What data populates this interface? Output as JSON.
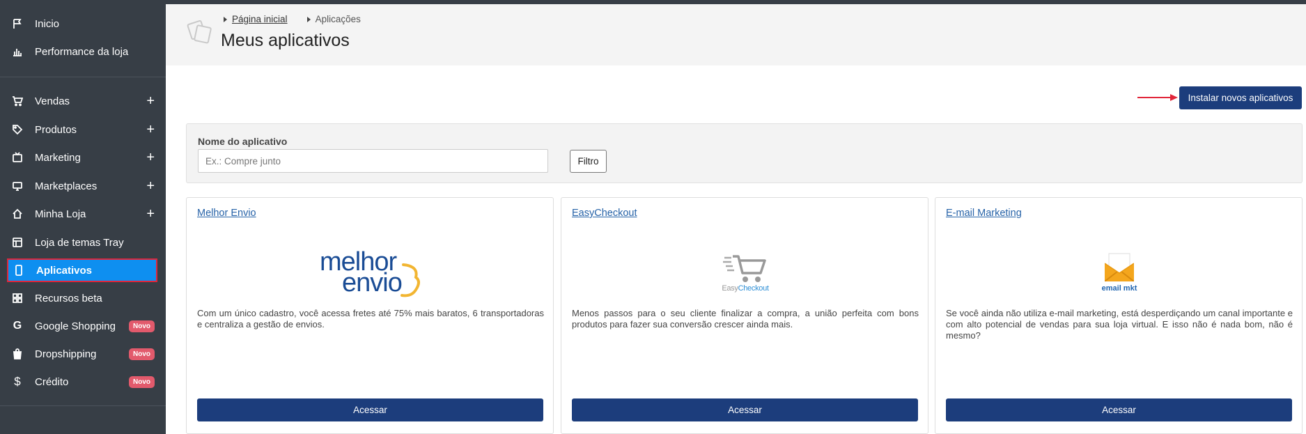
{
  "sidebar": {
    "items": [
      {
        "label": "Inicio",
        "icon": "flag-icon"
      },
      {
        "label": "Performance da loja",
        "icon": "bar-chart-icon"
      },
      {
        "label": "Vendas",
        "icon": "cart-icon",
        "expand": "+"
      },
      {
        "label": "Produtos",
        "icon": "tag-icon",
        "expand": "+"
      },
      {
        "label": "Marketing",
        "icon": "tv-icon",
        "expand": "+"
      },
      {
        "label": "Marketplaces",
        "icon": "monitor-icon",
        "expand": "+"
      },
      {
        "label": "Minha Loja",
        "icon": "home-icon",
        "expand": "+"
      },
      {
        "label": "Loja de temas Tray",
        "icon": "layout-icon"
      },
      {
        "label": "Aplicativos",
        "icon": "phone-icon",
        "active": true
      },
      {
        "label": "Recursos beta",
        "icon": "grid-icon"
      },
      {
        "label": "Google Shopping",
        "icon": "google-icon",
        "badge": "Novo"
      },
      {
        "label": "Dropshipping",
        "icon": "bag-icon",
        "badge": "Novo"
      },
      {
        "label": "Crédito",
        "icon": "dollar-icon",
        "badge": "Novo"
      }
    ]
  },
  "breadcrumb": {
    "home": "Página inicial",
    "current": "Aplicações"
  },
  "page": {
    "title": "Meus aplicativos",
    "install_button": "Instalar novos aplicativos"
  },
  "filter": {
    "label": "Nome do aplicativo",
    "placeholder": "Ex.: Compre junto",
    "button": "Filtro"
  },
  "apps": [
    {
      "title": "Melhor Envio",
      "logo_text_1": "melhor",
      "logo_text_2": "envio",
      "description": "Com um único cadastro, você acessa fretes até 75% mais baratos, 6 transportadoras e centraliza a gestão de envios.",
      "button": "Acessar"
    },
    {
      "title": "EasyCheckout",
      "logo_text_1": "Easy",
      "logo_text_2": "Checkout",
      "description": "Menos passos para o seu cliente finalizar a compra, a união perfeita com bons produtos para fazer sua conversão crescer ainda mais.",
      "button": "Acessar"
    },
    {
      "title": "E-mail Marketing",
      "logo_text_1": "email mkt",
      "description": "Se você ainda não utiliza e-mail marketing, está desperdiçando um canal importante e com alto potencial de vendas para sua loja virtual. E isso não é nada bom, não é mesmo?",
      "button": "Acessar"
    }
  ],
  "colors": {
    "sidebar_bg": "#373e46",
    "active_item": "#0e8ff0",
    "primary_button": "#1c3d7c",
    "link": "#2763a8",
    "badge": "#e25a6c",
    "annotation_red": "#e1263a"
  }
}
